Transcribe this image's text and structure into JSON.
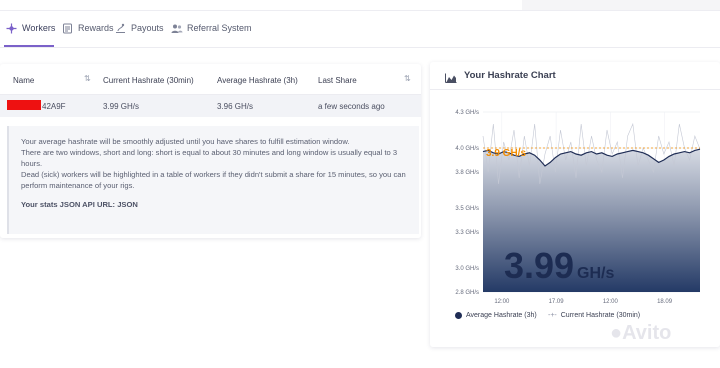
{
  "nav": {
    "tabs": [
      {
        "label": "Workers",
        "icon": "workers-icon"
      },
      {
        "label": "Rewards",
        "icon": "rewards-icon"
      },
      {
        "label": "Payouts",
        "icon": "payouts-icon"
      },
      {
        "label": "Referral System",
        "icon": "referral-icon"
      }
    ],
    "active_tab": "Workers",
    "accent": "#7b61c9"
  },
  "workers_table": {
    "columns": [
      "Name",
      "Current Hashrate (30min)",
      "Average Hashrate (3h)",
      "Last Share"
    ],
    "rows": [
      {
        "name": "42A9F",
        "current": "3.99 GH/s",
        "average": "3.96 GH/s",
        "last_share": "a few seconds ago"
      }
    ]
  },
  "info": {
    "line1": "Your average hashrate will be smoothly adjusted until you have shares to fulfill estimation window.",
    "line2": "There are two windows, short and long: short is equal to about 30 minutes and long window is usually equal to 3 hours.",
    "line3": "Dead (sick) workers will be highlighted in a table of workers if they didn't submit a share for 15 minutes, so you can perform maintenance of your rigs.",
    "api": "Your stats JSON API URL: JSON"
  },
  "hashrate_chart": {
    "title": "Your Hashrate Chart",
    "big_value": "3.99",
    "big_unit": "GH/s",
    "overlay_label": "3.9 GH/s"
  },
  "chart_data": {
    "type": "area",
    "unit": "GH/s",
    "ylim": [
      2.8,
      4.3
    ],
    "yticks": [
      "4.3 GH/s",
      "4.0 GH/s",
      "3.8 GH/s",
      "3.5 GH/s",
      "3.3 GH/s",
      "3.0 GH/s",
      "2.8 GH/s"
    ],
    "ytick_values": [
      4.3,
      4.0,
      3.8,
      3.5,
      3.3,
      3.0,
      2.8
    ],
    "xticks": [
      "12:00",
      "17.09",
      "12:00",
      "18.09"
    ],
    "xtick_positions": [
      0.05,
      0.3,
      0.55,
      0.8
    ],
    "legend": [
      "Average Hashrate (3h)",
      "Current Hashrate (30min)"
    ],
    "series": [
      {
        "name": "Average Hashrate (3h)",
        "color": "#1f2d55",
        "values": [
          3.97,
          3.98,
          3.96,
          3.95,
          3.97,
          3.96,
          3.94,
          3.93,
          3.95,
          3.96,
          3.94,
          3.9,
          3.85,
          3.88,
          3.92,
          3.95,
          3.96,
          3.97,
          3.95,
          3.94,
          3.96,
          3.97,
          3.95,
          3.96,
          3.94,
          3.93,
          3.95,
          3.96,
          3.97,
          3.98,
          3.97,
          3.96,
          3.94,
          3.91,
          3.88,
          3.9,
          3.93,
          3.95,
          3.96,
          3.97,
          3.96,
          3.98,
          3.99
        ]
      },
      {
        "name": "Current Hashrate (30min)",
        "color": "#8a8fa3",
        "values": [
          4.1,
          3.8,
          4.2,
          3.7,
          4.05,
          3.9,
          4.15,
          3.75,
          4.1,
          3.85,
          4.2,
          3.7,
          3.95,
          4.1,
          3.8,
          4.15,
          3.9,
          4.05,
          3.75,
          4.2,
          3.85,
          4.1,
          3.9,
          3.8,
          4.15,
          3.95,
          4.05,
          3.75,
          4.1,
          4.2,
          3.85,
          4.0,
          3.9,
          3.8,
          4.1,
          3.95,
          4.05,
          3.85,
          4.2,
          4.0,
          3.9,
          4.1,
          3.99
        ]
      }
    ],
    "grid": true
  }
}
